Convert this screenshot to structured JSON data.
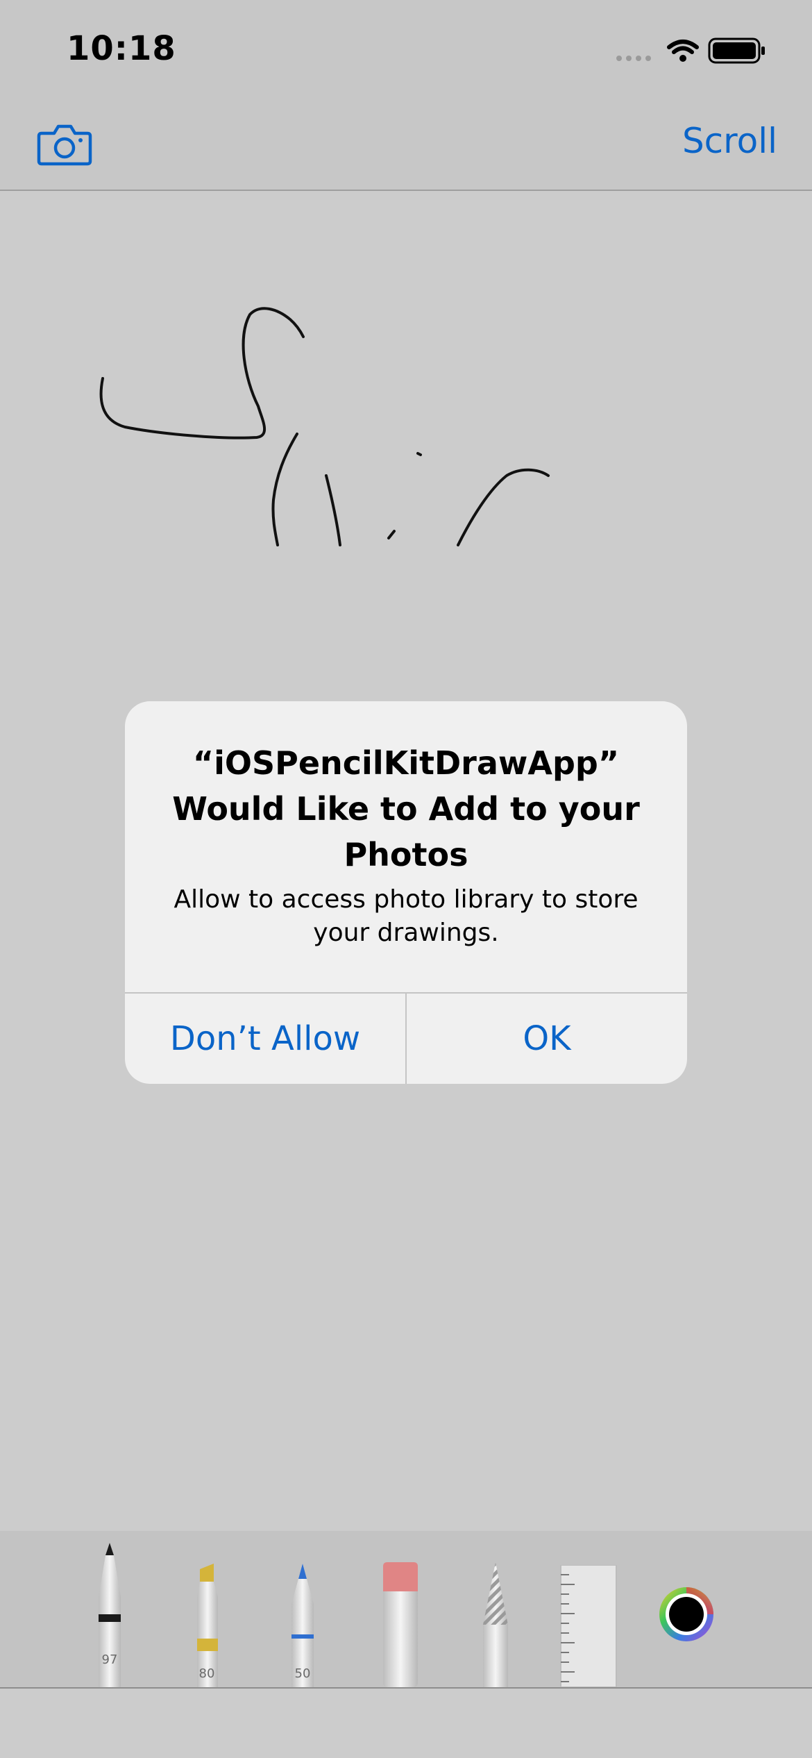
{
  "status_bar": {
    "time": "10:18"
  },
  "nav_bar": {
    "scroll_label": "Scroll",
    "camera_icon": "camera-icon"
  },
  "alert": {
    "title_line1": "“iOSPencilKitDrawApp”",
    "title_line2": "Would Like to Add to your",
    "title_line3": "Photos",
    "message_line1": "Allow to access photo library to store",
    "message_line2": "your drawings.",
    "deny_label": "Don’t Allow",
    "ok_label": "OK"
  },
  "toolbar": {
    "tools": [
      {
        "name": "pen",
        "icon": "pen-icon",
        "label": "97",
        "color": "#1a1a1a"
      },
      {
        "name": "marker",
        "icon": "marker-icon",
        "label": "80",
        "color": "#d4b43a"
      },
      {
        "name": "pencil",
        "icon": "pencil-icon",
        "label": "50",
        "color": "#2f6fd0"
      },
      {
        "name": "eraser",
        "icon": "eraser-icon",
        "label": "",
        "color": "#e08585"
      },
      {
        "name": "lasso",
        "icon": "lasso-icon",
        "label": "",
        "color": "#9a9a9a"
      },
      {
        "name": "ruler",
        "icon": "ruler-icon",
        "label": "",
        "color": "#e8e8e8"
      }
    ],
    "color_picker": {
      "icon": "color-wheel-icon",
      "selected_color": "#000000"
    }
  },
  "colors": {
    "accent": "#0a64c8",
    "background": "#cccccc",
    "alert_background": "#f0f0f0"
  }
}
